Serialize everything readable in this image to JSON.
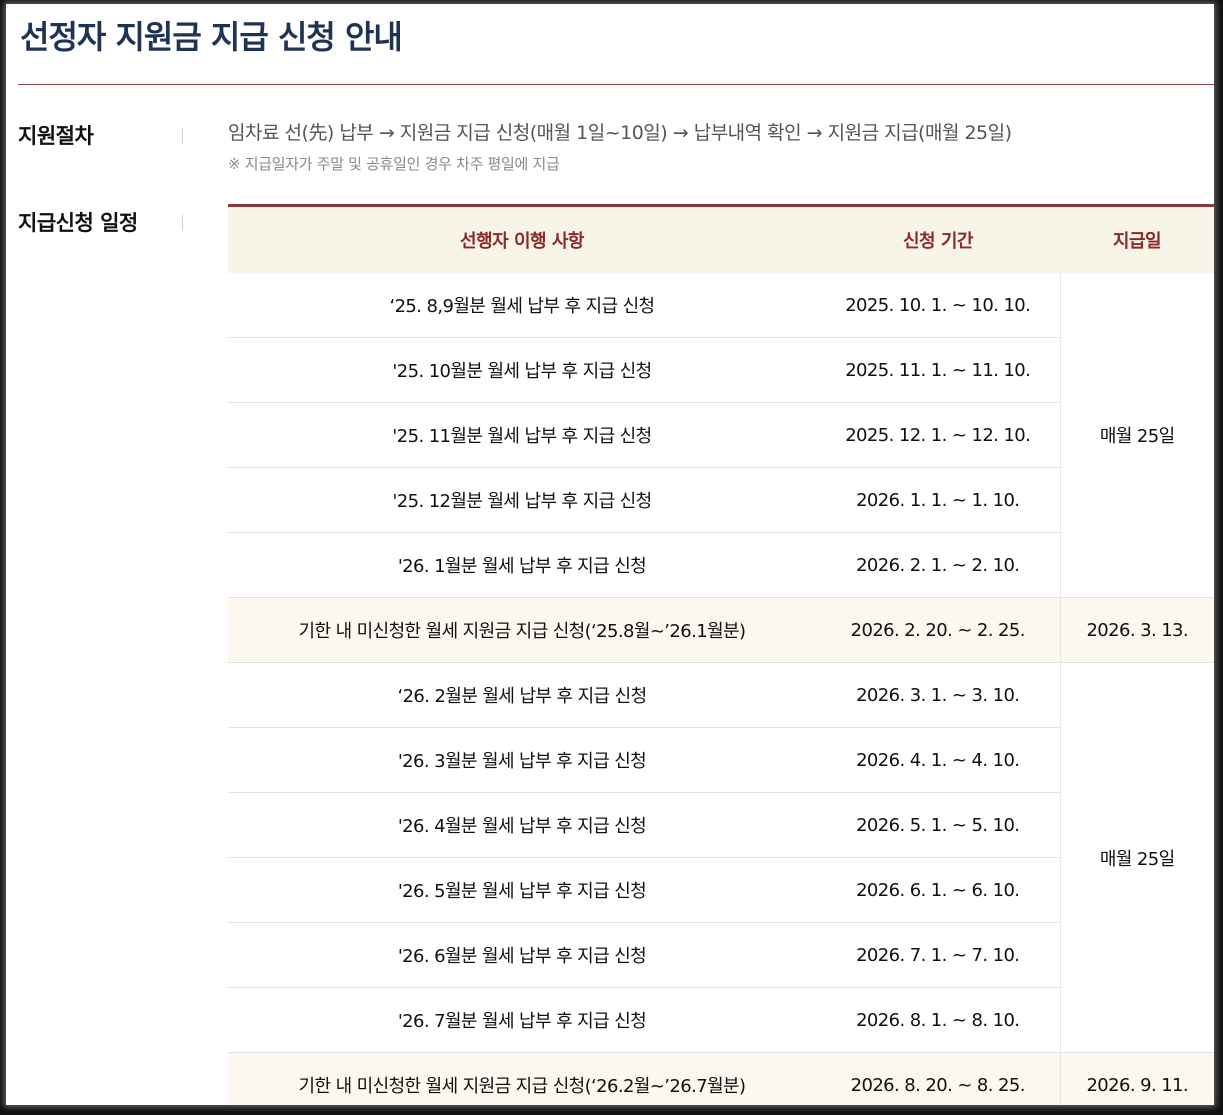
{
  "page": {
    "title": "선정자 지원금 지급 신청 안내"
  },
  "procedure": {
    "label": "지원절차",
    "steps_text": "임차료 선(先) 납부 → 지원금 지급 신청(매월 1일~10일) → 납부내역 확인 → 지원금 지급(매월 25일)",
    "note": "※ 지급일자가 주말 및 공휴일인 경우 차주 평일에 지급"
  },
  "schedule": {
    "label": "지급신청 일정",
    "headers": {
      "item": "선행자 이행 사항",
      "period": "신청 기간",
      "pay_date": "지급일"
    },
    "rows": [
      {
        "item": "‘25. 8,9월분 월세 납부 후 지급 신청",
        "period": "2025. 10. 1. ~ 10. 10."
      },
      {
        "item": "'25. 10월분 월세 납부 후 지급 신청",
        "period": "2025. 11. 1. ~ 11. 10."
      },
      {
        "item": "'25. 11월분 월세 납부 후 지급 신청",
        "period": "2025. 12. 1. ~ 12. 10."
      },
      {
        "item": "'25. 12월분 월세 납부 후 지급 신청",
        "period": "2026. 1. 1. ~ 1. 10."
      },
      {
        "item": "'26. 1월분 월세 납부 후 지급 신청",
        "period": "2026. 2. 1. ~ 2. 10."
      },
      {
        "item": "기한 내 미신청한 월세 지원금 지급 신청(‘25.8월~’26.1월분)",
        "period": "2026. 2. 20. ~ 2. 25.",
        "pay": "2026. 3. 13."
      },
      {
        "item": "‘26. 2월분 월세 납부 후 지급 신청",
        "period": "2026. 3. 1. ~ 3. 10."
      },
      {
        "item": "'26. 3월분 월세 납부 후 지급 신청",
        "period": "2026. 4. 1. ~ 4. 10."
      },
      {
        "item": "'26. 4월분 월세 납부 후 지급 신청",
        "period": "2026. 5. 1. ~ 5. 10."
      },
      {
        "item": "'26. 5월분 월세 납부 후 지급 신청",
        "period": "2026. 6. 1. ~ 6. 10."
      },
      {
        "item": "'26. 6월분 월세 납부 후 지급 신청",
        "period": "2026. 7. 1. ~ 7. 10."
      },
      {
        "item": "'26. 7월분 월세 납부 후 지급 신청",
        "period": "2026. 8. 1. ~ 8. 10."
      },
      {
        "item": "기한 내 미신청한 월세 지원금 지급 신청(‘26.2월~’26.7월분)",
        "period": "2026. 8. 20. ~ 8. 25.",
        "pay": "2026. 9. 11."
      }
    ],
    "monthly_pay_1": "매월 25일",
    "monthly_pay_2": "매월 25일"
  }
}
